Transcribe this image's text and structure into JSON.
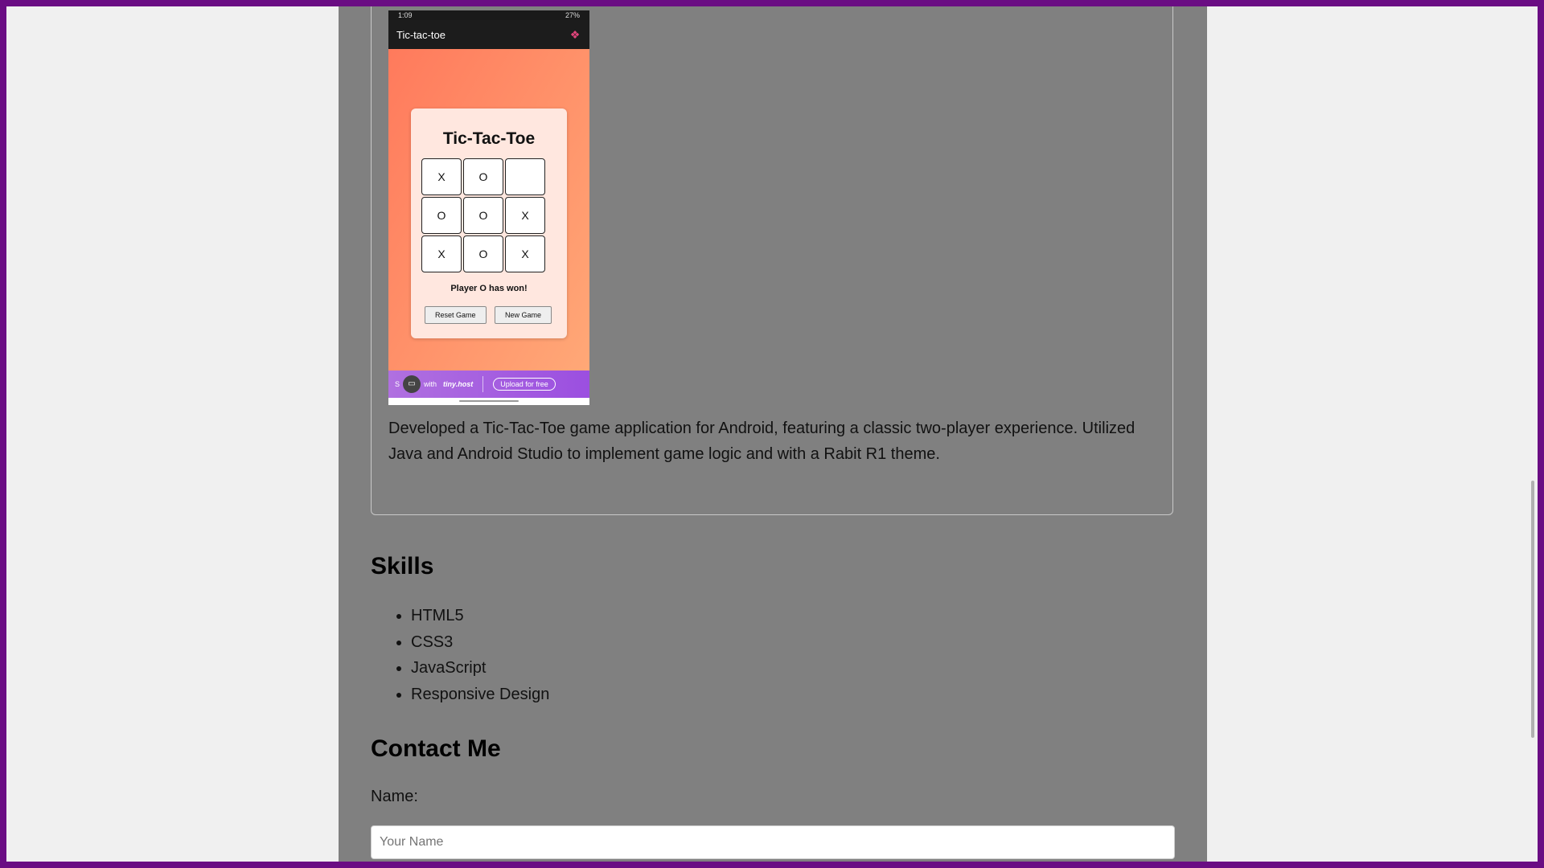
{
  "phone": {
    "status_time": "1:09",
    "status_right": "27%",
    "app_title": "Tic-tac-toe",
    "game_title": "Tic-Tac-Toe",
    "board": [
      "X",
      "O",
      "",
      "O",
      "O",
      "X",
      "X",
      "O",
      "X"
    ],
    "status_message": "Player O has won!",
    "reset_label": "Reset Game",
    "new_label": "New Game",
    "banner_prefix": "S",
    "banner_with": "with",
    "banner_brand": "tiny.host",
    "banner_upload": "Upload for free"
  },
  "project": {
    "description": "Developed a Tic-Tac-Toe game application for Android, featuring a classic two-player experience. Utilized Java and Android Studio to implement game logic and with a Rabit R1 theme."
  },
  "skills": {
    "heading": "Skills",
    "items": [
      "HTML5",
      "CSS3",
      "JavaScript",
      "Responsive Design"
    ]
  },
  "contact": {
    "heading": "Contact Me",
    "name_label": "Name:",
    "name_placeholder": "Your Name"
  },
  "colors": {
    "frame": "#6a0d83",
    "page_bg": "#808080",
    "outer_bg": "#f0f0f0"
  }
}
